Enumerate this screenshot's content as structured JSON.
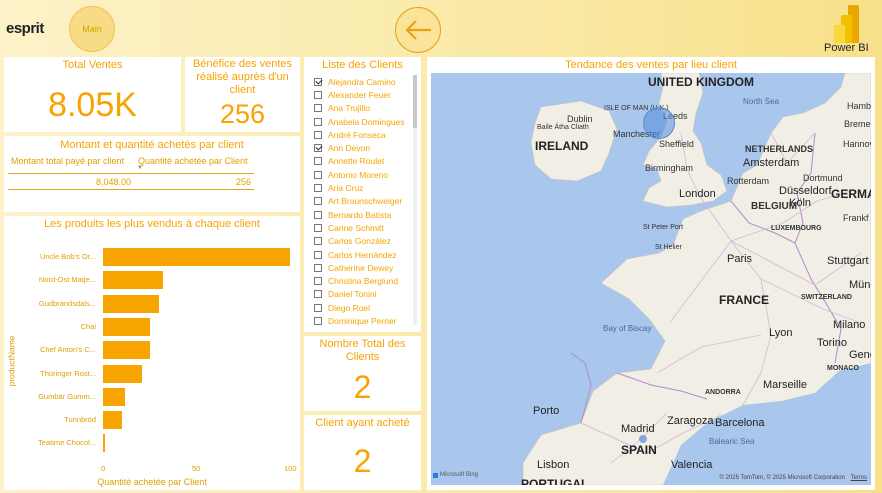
{
  "header": {
    "logo_text": "esprit",
    "main_button": "Main",
    "back_icon": "arrow-left-icon",
    "powerbi_label": "Power BI"
  },
  "kpi_total_sales": {
    "title": "Total Ventes",
    "value": "8.05K"
  },
  "kpi_profit": {
    "title": "Bénéfice des ventes réalisé auprès d'un client",
    "value": "256"
  },
  "amount_table": {
    "title": "Montant et quantité achetés par client",
    "col1": "Montant total payé par client",
    "col2": "Quantité achetée par Client",
    "val1": "8,048.00",
    "val2": "256"
  },
  "bar_chart": {
    "title": "Les produits les plus vendus à chaque client",
    "ylabel": "productName",
    "xlabel": "Quantité achetée par Client",
    "ticks": [
      "0",
      "50",
      "100"
    ]
  },
  "chart_data": {
    "type": "bar",
    "orientation": "horizontal",
    "title": "Les produits les plus vendus à chaque client",
    "xlabel": "Quantité achetée par Client",
    "ylabel": "productName",
    "categories": [
      "Uncle Bob's Or...",
      "Nord-Ost Matje...",
      "Gudbrandsdals...",
      "Chai",
      "Chef Anton's C...",
      "Thüringer Rost...",
      "Gumbär Gumm...",
      "Tunnbröd",
      "Teatime Chocol..."
    ],
    "values": [
      100,
      32,
      30,
      25,
      25,
      21,
      12,
      10,
      1
    ],
    "xlim": [
      0,
      100
    ]
  },
  "client_list": {
    "title": "Liste des Clients",
    "items": [
      {
        "name": "Alejandra Camino",
        "checked": true
      },
      {
        "name": "Alexander Feuer",
        "checked": false
      },
      {
        "name": "Ana Trujillo",
        "checked": false
      },
      {
        "name": "Anabela Domingues",
        "checked": false
      },
      {
        "name": "André Fonseca",
        "checked": false
      },
      {
        "name": "Ann Devon",
        "checked": true
      },
      {
        "name": "Annette Roulet",
        "checked": false
      },
      {
        "name": "Antonio Moreno",
        "checked": false
      },
      {
        "name": "Aria Cruz",
        "checked": false
      },
      {
        "name": "Art Braunschweiger",
        "checked": false
      },
      {
        "name": "Bernardo Batista",
        "checked": false
      },
      {
        "name": "Carine Schmitt",
        "checked": false
      },
      {
        "name": "Carlos González",
        "checked": false
      },
      {
        "name": "Carlos Hernández",
        "checked": false
      },
      {
        "name": "Catherine Dewey",
        "checked": false
      },
      {
        "name": "Christina Berglund",
        "checked": false
      },
      {
        "name": "Daniel Tonini",
        "checked": false
      },
      {
        "name": "Diego Roel",
        "checked": false
      },
      {
        "name": "Dominique Perrier",
        "checked": false
      }
    ]
  },
  "kpi_total_clients": {
    "title": "Nombre Total des Clients",
    "value": "2"
  },
  "kpi_buying_clients": {
    "title": "Client ayant acheté",
    "value": "2"
  },
  "map": {
    "title": "Tendance des ventes par lieu client",
    "labels": {
      "uk": "UNITED KINGDOM",
      "isle_of_man": "ISLE OF MAN (U.K.)",
      "north_sea": "North Sea",
      "dublin": "Dublin",
      "baile_atha_cliath": "Baile Átha Cliath",
      "ireland": "IRELAND",
      "leeds": "Leeds",
      "manchester": "Manchester",
      "sheffield": "Sheffield",
      "birmingham": "Birmingham",
      "london": "London",
      "bremen": "Bremen",
      "hamburg": "Hamburg",
      "hannover": "Hannover",
      "netherlands": "NETHERLANDS",
      "amsterdam": "Amsterdam",
      "rotterdam": "Rotterdam",
      "dortmund": "Dortmund",
      "dusseldorf": "Düsseldorf",
      "koln": "Köln",
      "german": "GERMA",
      "belgium": "BELGIUM",
      "luxembourg": "LUXEMBOURG",
      "frankfurt": "Frankf",
      "st_peter_port": "St Peter Port",
      "st_helier": "St Helier",
      "paris": "Paris",
      "stuttgart": "Stuttgart",
      "munchen": "Münch",
      "france": "FRANCE",
      "switzerland": "SWITZERLAND",
      "bay_of_biscay": "Bay of Biscay",
      "milano": "Milano",
      "torino": "Torino",
      "lyon": "Lyon",
      "monaco": "MONACO",
      "genova": "Genova",
      "marseille": "Marseille",
      "andorra": "ANDORRA",
      "porto": "Porto",
      "zaragoza": "Zaragoza",
      "barcelona": "Barcelona",
      "madrid": "Madrid",
      "spain": "SPAIN",
      "balearic_sea": "Balearic Sea",
      "lisbon": "Lisbon",
      "valencia": "Valencia",
      "portugal": "PORTUGAL"
    },
    "attribution_logo": "Microsoft Bing",
    "copyright": "© 2025 TomTom, © 2025 Microsoft Corporation",
    "terms": "Terms"
  },
  "colors": {
    "accent": "#f7a300",
    "background_start": "#fdf2c8",
    "background_end": "#f7e089",
    "sea": "#a9c6ec",
    "land": "#f1eee6"
  }
}
